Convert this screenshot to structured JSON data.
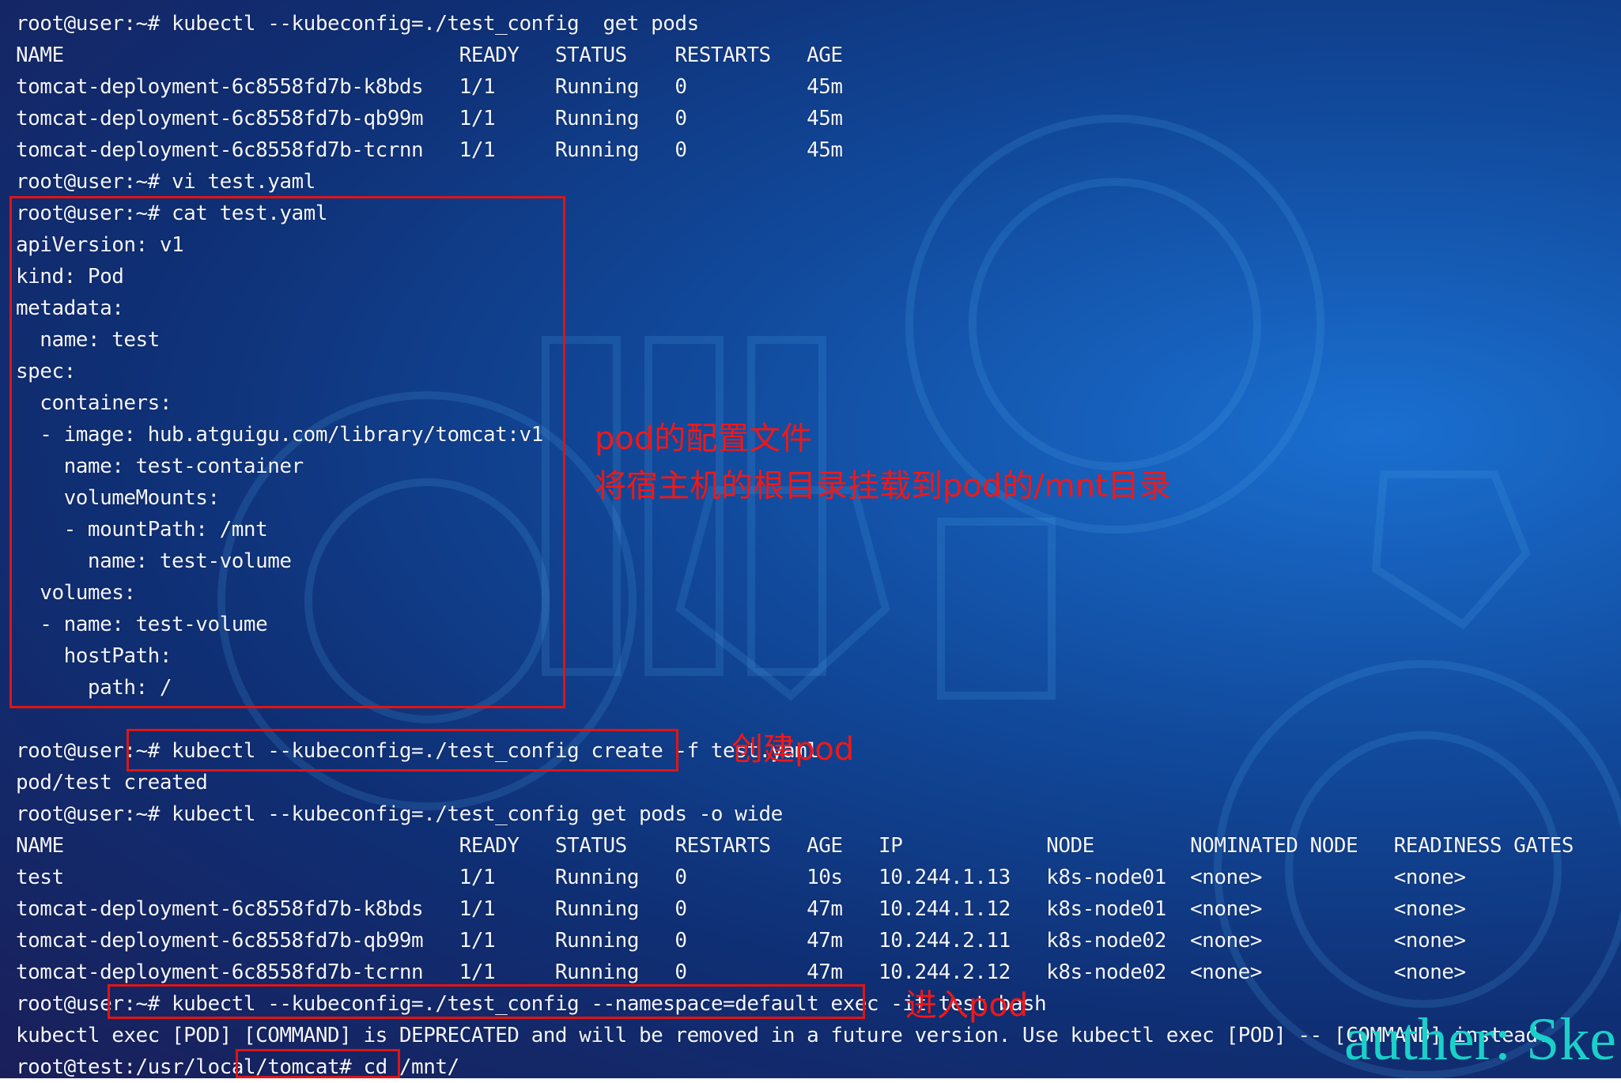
{
  "terminal": {
    "lines": [
      "root@user:~# kubectl --kubeconfig=./test_config  get pods",
      "NAME                                 READY   STATUS    RESTARTS   AGE",
      "tomcat-deployment-6c8558fd7b-k8bds   1/1     Running   0          45m",
      "tomcat-deployment-6c8558fd7b-qb99m   1/1     Running   0          45m",
      "tomcat-deployment-6c8558fd7b-tcrnn   1/1     Running   0          45m",
      "root@user:~# vi test.yaml",
      "root@user:~# cat test.yaml",
      "apiVersion: v1",
      "kind: Pod",
      "metadata:",
      "  name: test",
      "spec:",
      "  containers:",
      "  - image: hub.atguigu.com/library/tomcat:v1",
      "    name: test-container",
      "    volumeMounts:",
      "    - mountPath: /mnt",
      "      name: test-volume",
      "  volumes:",
      "  - name: test-volume",
      "    hostPath:",
      "      path: /",
      "",
      "root@user:~# kubectl --kubeconfig=./test_config create -f test.yaml",
      "pod/test created",
      "root@user:~# kubectl --kubeconfig=./test_config get pods -o wide",
      "NAME                                 READY   STATUS    RESTARTS   AGE   IP            NODE        NOMINATED NODE   READINESS GATES",
      "test                                 1/1     Running   0          10s   10.244.1.13   k8s-node01  <none>           <none>",
      "tomcat-deployment-6c8558fd7b-k8bds   1/1     Running   0          47m   10.244.1.12   k8s-node01  <none>           <none>",
      "tomcat-deployment-6c8558fd7b-qb99m   1/1     Running   0          47m   10.244.2.11   k8s-node02  <none>           <none>",
      "tomcat-deployment-6c8558fd7b-tcrnn   1/1     Running   0          47m   10.244.2.12   k8s-node02  <none>           <none>",
      "root@user:~# kubectl --kubeconfig=./test_config --namespace=default exec -it test bash",
      "kubectl exec [POD] [COMMAND] is DEPRECATED and will be removed in a future version. Use kubectl exec [POD] -- [COMMAND] instead.",
      "root@test:/usr/local/tomcat# cd /mnt/"
    ]
  },
  "annotations": {
    "config_title": "pod的配置文件",
    "config_desc": "将宿主机的根目录挂载到pod的/mnt目录",
    "create_pod": "创建pod",
    "enter_pod": "进入pod"
  },
  "watermark": "auther: Ske",
  "colors": {
    "background": "#114a9c",
    "text": "#f2f4ff",
    "annotation": "#f01818",
    "watermark": "#1bd0c8"
  }
}
